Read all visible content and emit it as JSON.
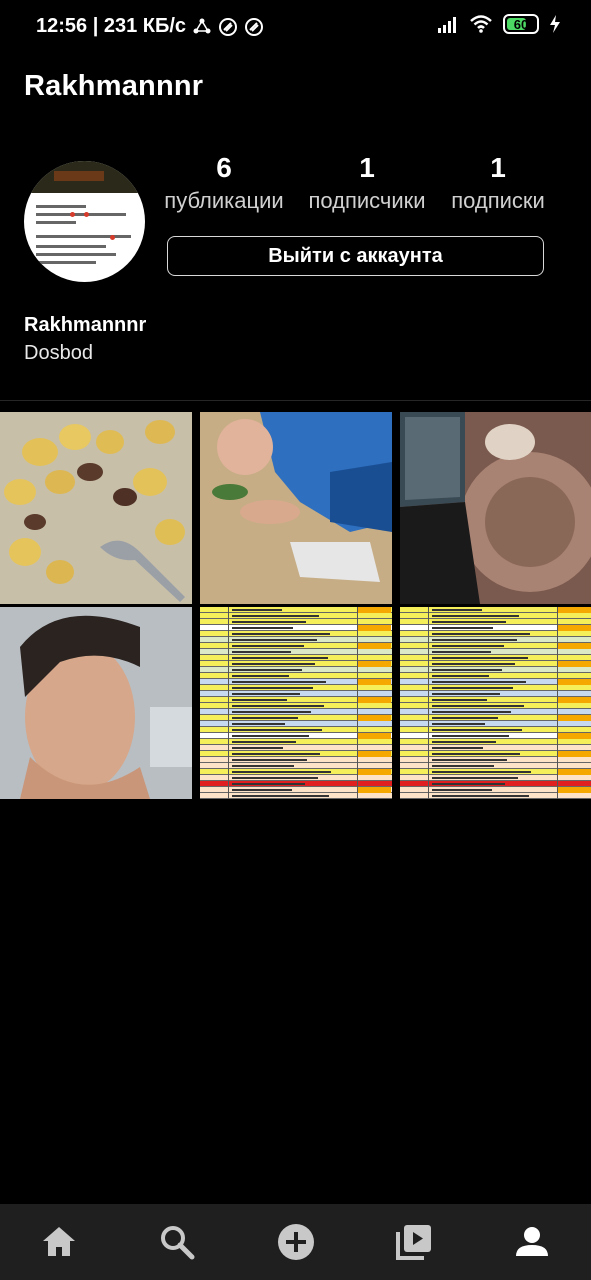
{
  "status_bar": {
    "time_and_speed": "12:56 | 231 КБ/с",
    "battery": "60"
  },
  "header": {
    "username": "Rakhmannnr"
  },
  "profile": {
    "posts_count": "6",
    "posts_label": "публикации",
    "followers_count": "1",
    "followers_label": "подписчики",
    "following_count": "1",
    "following_label": "подписки",
    "logout_label": "Выйти с аккаунта",
    "display_name": "Rakhmannnr",
    "bio": "Dosbod"
  },
  "bottom_nav": {
    "items": [
      {
        "icon": "home-icon"
      },
      {
        "icon": "search-icon"
      },
      {
        "icon": "add-icon"
      },
      {
        "icon": "reels-icon"
      },
      {
        "icon": "profile-icon"
      }
    ]
  },
  "colors": {
    "background": "#000000",
    "nav_background": "#1f1f1f",
    "battery": "#4cd964"
  }
}
